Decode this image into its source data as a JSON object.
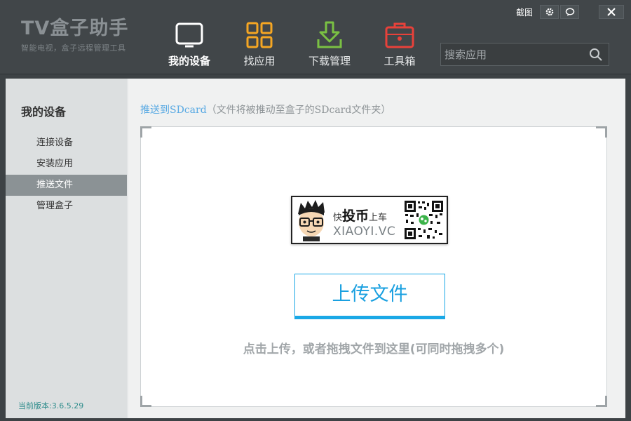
{
  "brand": {
    "title": "TV盒子助手",
    "subtitle": "智能电视，盒子远程管理工具"
  },
  "nav": {
    "items": [
      {
        "label": "我的设备",
        "icon": "tv-icon",
        "active": true
      },
      {
        "label": "找应用",
        "icon": "apps-grid-icon",
        "active": false
      },
      {
        "label": "下载管理",
        "icon": "download-icon",
        "active": false
      },
      {
        "label": "工具箱",
        "icon": "toolbox-icon",
        "active": false
      }
    ]
  },
  "window": {
    "screenshot_label": "截图",
    "settings_icon": "gear-icon",
    "feedback_icon": "chat-bubble-icon",
    "close_icon": "close-icon"
  },
  "search": {
    "placeholder": "搜索应用",
    "icon": "search-icon"
  },
  "sidebar": {
    "title": "我的设备",
    "items": [
      {
        "label": "连接设备",
        "active": false
      },
      {
        "label": "安装应用",
        "active": false
      },
      {
        "label": "推送文件",
        "active": true
      },
      {
        "label": "管理盒子",
        "active": false
      }
    ],
    "version": "当前版本:3.6.5.29"
  },
  "main": {
    "push_link": "推送到SDcard",
    "push_desc": "（文件将被推动至盒子的SDcard文件夹）",
    "banner": {
      "slogan_pre": "快",
      "slogan_big": "投币",
      "slogan_post": "上车",
      "site": "XIAOYI.VC"
    },
    "upload_label": "上传文件",
    "hint": "点击上传，或者拖拽文件到这里(可同时拖拽多个)"
  },
  "colors": {
    "accent": "#1aa8e6",
    "link": "#58a9e3",
    "nav_apps": "#f5a623",
    "nav_download": "#7ac143",
    "nav_toolbox": "#e8413a",
    "version": "#2f8d8c"
  }
}
